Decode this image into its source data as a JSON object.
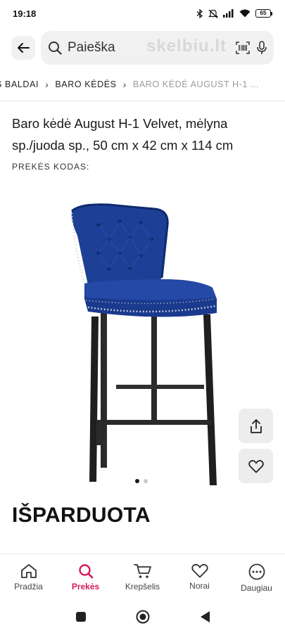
{
  "status_bar": {
    "time": "19:18",
    "battery": "65",
    "icons": [
      "bluetooth-icon",
      "mute-icon",
      "signal-icon",
      "wifi-icon",
      "battery-icon"
    ]
  },
  "search": {
    "placeholder": "Paieška",
    "watermark": "skelbiu.lt"
  },
  "breadcrumb": {
    "items": [
      "S BALDAI",
      "BARO KĖDĖS",
      "BARO KĖDĖ AUGUST H-1"
    ],
    "ellipsis": "..."
  },
  "product": {
    "title": "Baro kėdė August H-1 Velvet, mėlyna sp./juoda sp., 50 cm x 42 cm x 114 cm",
    "code_label": "PREKĖS KODAS:",
    "status": "IŠPARDUOTA",
    "image_count": 2,
    "image_index": 1
  },
  "colors": {
    "accent": "#d6185d",
    "velvet": "#1d3f96",
    "legs": "#2a2a2a",
    "button_bg": "#ededed"
  },
  "bottom_nav": {
    "items": [
      {
        "label": "Pradžia",
        "icon": "home-icon"
      },
      {
        "label": "Prekės",
        "icon": "search-icon",
        "active": true
      },
      {
        "label": "Krepšelis",
        "icon": "cart-icon"
      },
      {
        "label": "Norai",
        "icon": "heart-icon"
      },
      {
        "label": "Daugiau",
        "icon": "more-icon"
      }
    ]
  }
}
